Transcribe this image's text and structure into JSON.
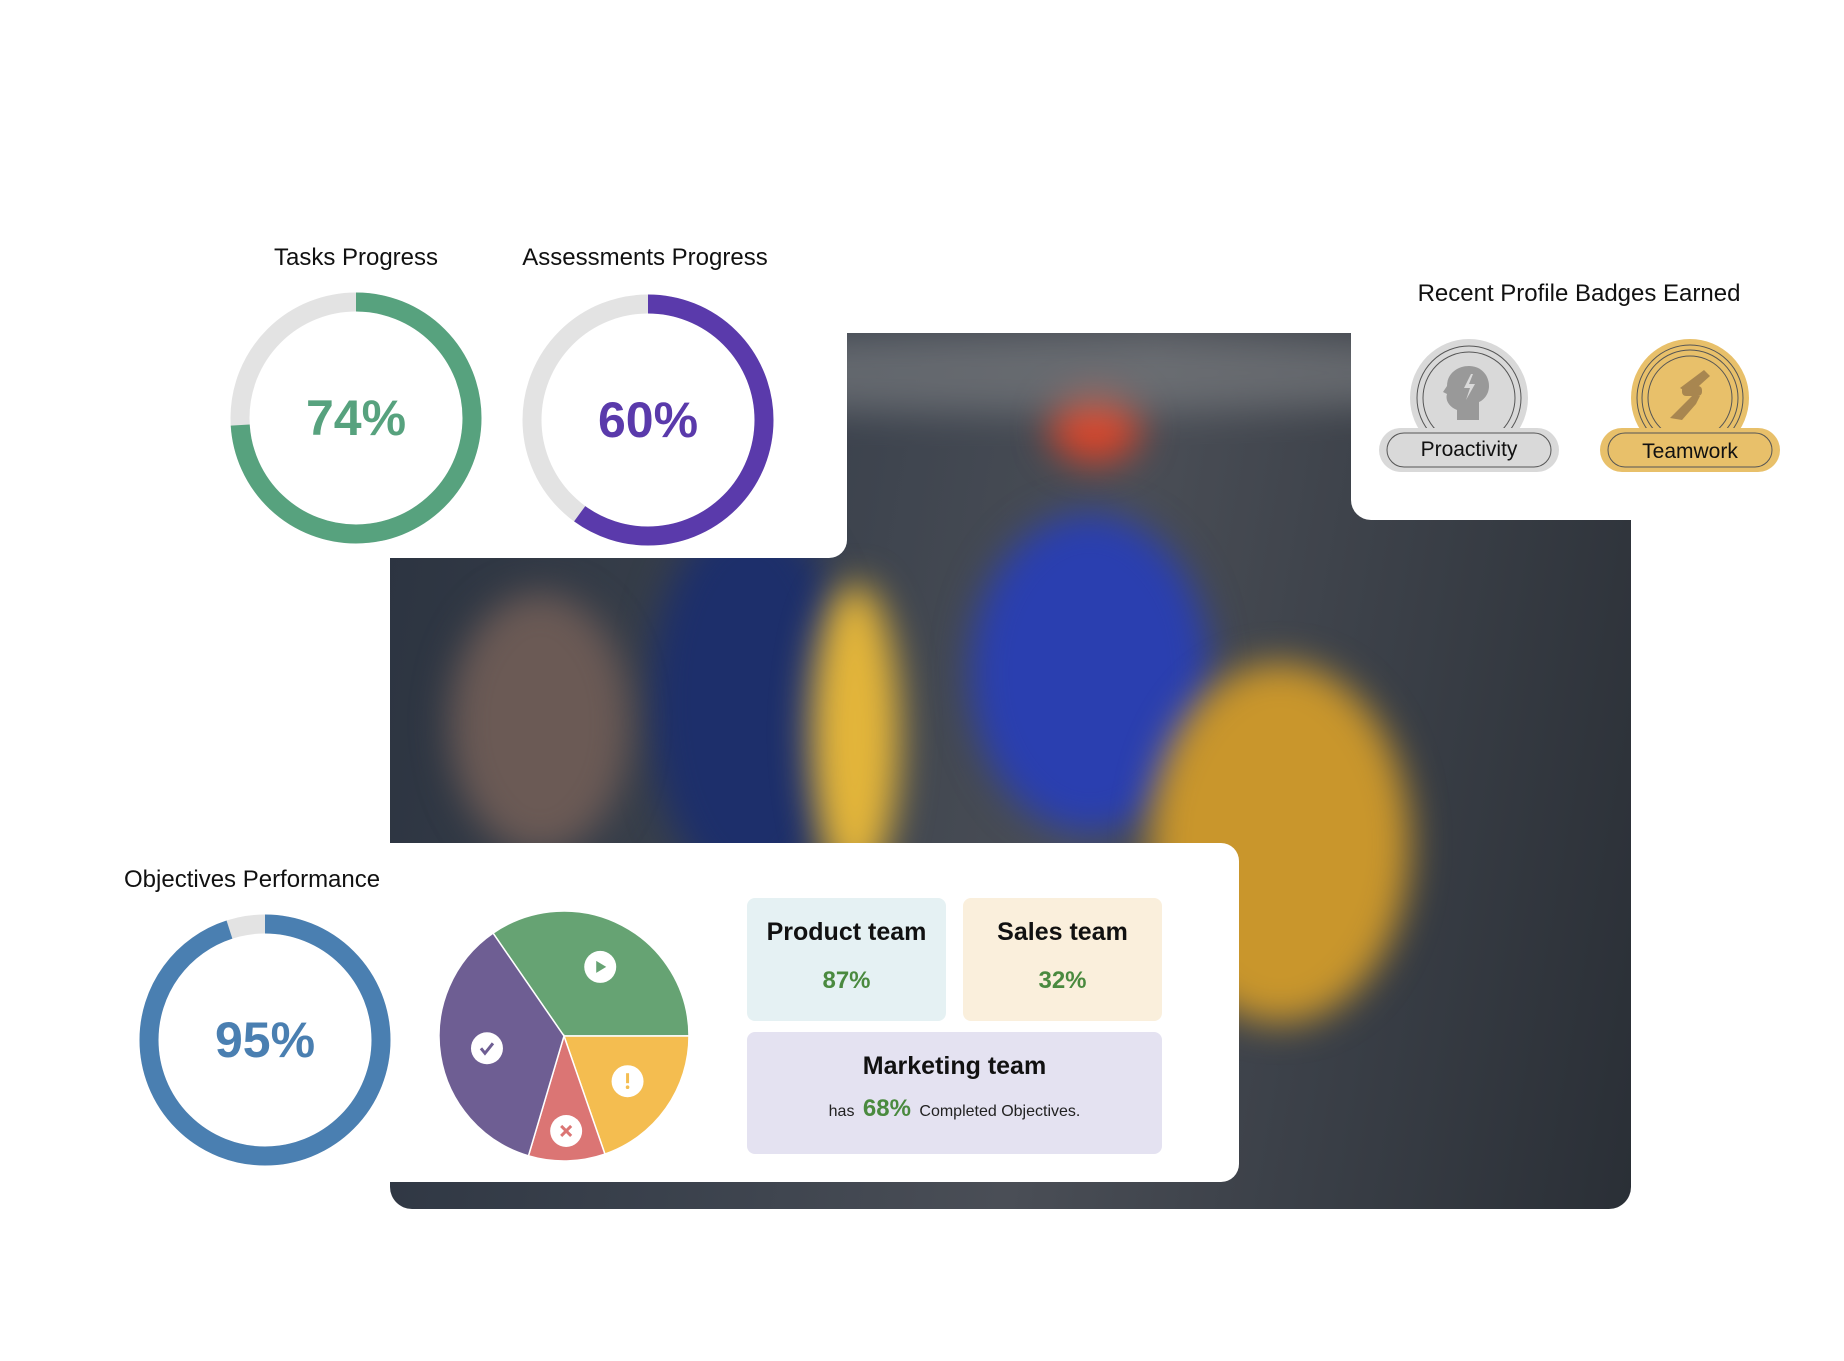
{
  "tasks_progress": {
    "title": "Tasks Progress",
    "value": 74,
    "label": "74%",
    "color": "#57a27e"
  },
  "assessments_progress": {
    "title": "Assessments Progress",
    "value": 60,
    "label": "60%",
    "color": "#5a3aab"
  },
  "badges": {
    "title": "Recent Profile Badges Earned",
    "items": [
      {
        "label": "Proactivity",
        "icon": "head-lightning-icon",
        "color": "#d9d9d9"
      },
      {
        "label": "Teamwork",
        "icon": "handshake-icon",
        "color": "#e8c06a"
      }
    ]
  },
  "objectives": {
    "title": "Objectives Performance",
    "value": 95,
    "label": "95%",
    "color": "#4a7fb1",
    "pie": [
      {
        "icon": "play-icon",
        "percent": 34.6,
        "color": "#66a373"
      },
      {
        "icon": "exclamation-icon",
        "percent": 19.7,
        "color": "#f4bd50"
      },
      {
        "icon": "x-icon",
        "percent": 9.9,
        "color": "#db7574"
      },
      {
        "icon": "check-icon",
        "percent": 35.8,
        "color": "#6e5e93"
      }
    ],
    "teams": {
      "product": {
        "name": "Product team",
        "percent": "87%"
      },
      "sales": {
        "name": "Sales team",
        "percent": "32%"
      },
      "marketing": {
        "name": "Marketing team",
        "prefix": "has",
        "percent": "68%",
        "suffix": "Completed Objectives."
      }
    }
  },
  "track_color": "#e3e3e3"
}
